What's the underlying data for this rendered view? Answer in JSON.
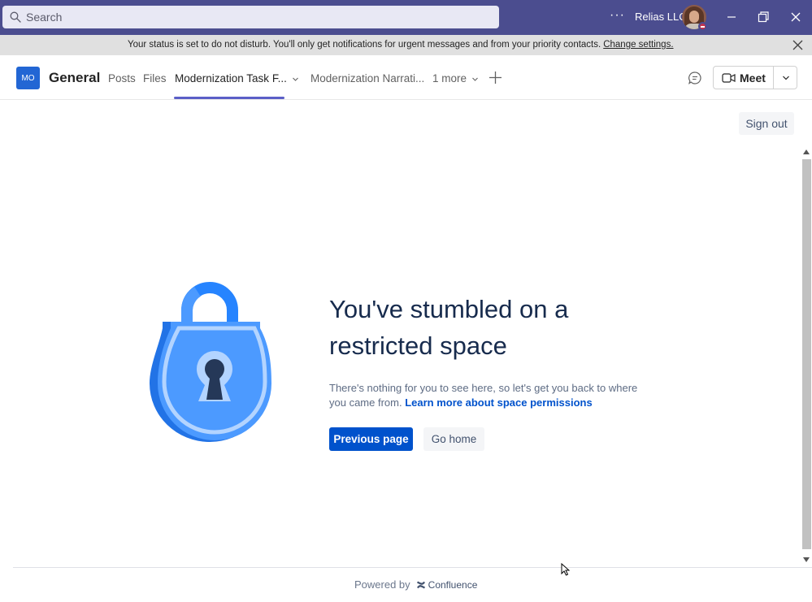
{
  "titlebar": {
    "search_placeholder": "Search",
    "more_label": "···",
    "org_name": "Relias LLC",
    "presence_status": "do-not-disturb"
  },
  "banner": {
    "message": "Your status is set to do not disturb. You'll only get notifications for urgent messages and from your priority contacts.",
    "link": "Change settings."
  },
  "channel": {
    "team_initials": "MO",
    "name": "General",
    "tabs": [
      {
        "label": "Posts"
      },
      {
        "label": "Files"
      },
      {
        "label": "Modernization Task F..."
      },
      {
        "label": "Modernization Narrati..."
      },
      {
        "label": "1 more"
      }
    ],
    "active_tab": "Modernization Task F...",
    "meet_label": "Meet"
  },
  "content": {
    "sign_out": "Sign out",
    "headline": "You've stumbled on a restricted space",
    "description": "There's nothing for you to see here, so let's get you back to where you came from.",
    "learn_more": "Learn more about space permissions",
    "previous_page": "Previous page",
    "go_home": "Go home"
  },
  "footer": {
    "powered_by": "Powered by",
    "brand": "Confluence"
  },
  "colors": {
    "titlebar": "#4b4d8f",
    "accent": "#5b5fc7",
    "primary_button": "#0052cc",
    "lock_blue": "#4c9aff",
    "dnd_red": "#c4314b"
  },
  "icons": [
    "search-icon",
    "minimize-icon",
    "restore-icon",
    "close-icon",
    "banner-close-icon",
    "chevron-down-icon",
    "add-tab-icon",
    "chat-icon",
    "video-camera-icon",
    "lock-icon",
    "confluence-logo-icon"
  ]
}
